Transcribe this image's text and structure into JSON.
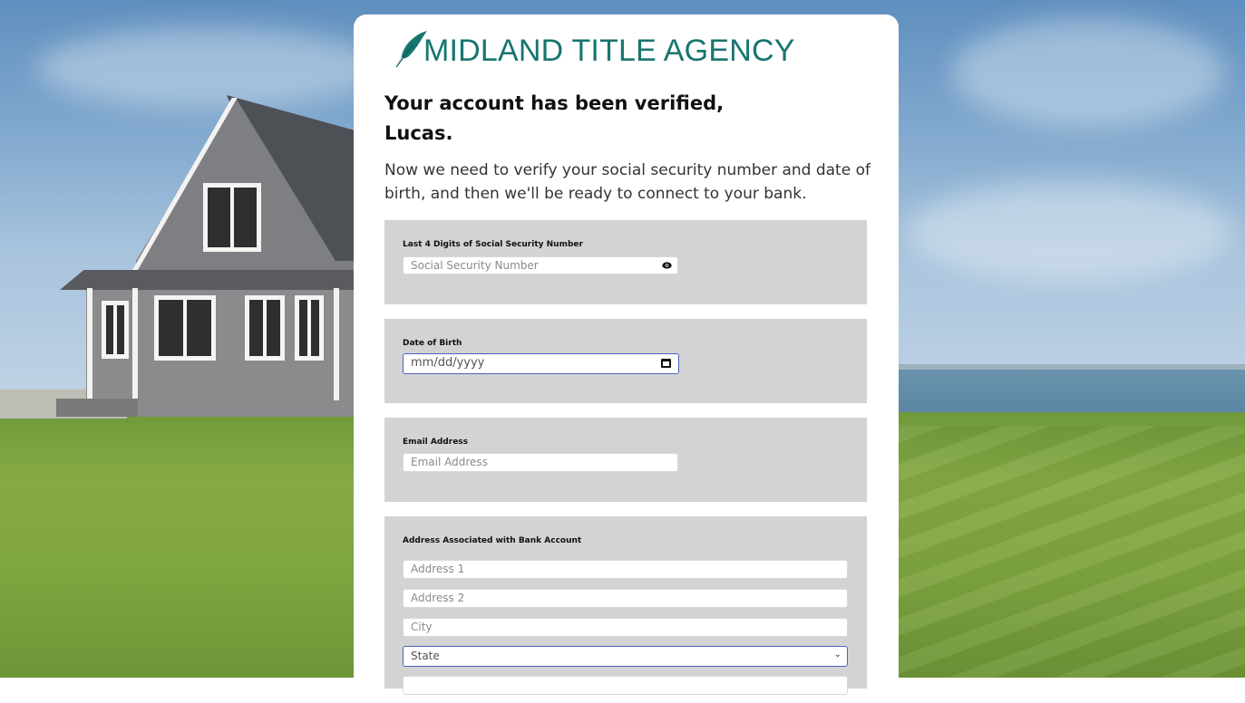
{
  "brand": {
    "name": "MIDLAND TITLE AGENCY",
    "color": "#17756f"
  },
  "heading": {
    "line1": "Your account has been verified,",
    "line2": "Lucas."
  },
  "intro": "Now we need to verify your social security number and date of birth, and then we'll be ready to connect to your bank.",
  "ssn": {
    "label": "Last 4 Digits of Social Security Number",
    "placeholder": "Social Security Number",
    "icon": "eye-icon"
  },
  "dob": {
    "label": "Date of Birth",
    "placeholder": "mm/dd/yyyy",
    "icon": "calendar-icon"
  },
  "email": {
    "label": "Email Address",
    "placeholder": "Email Address"
  },
  "address": {
    "label": "Address Associated with Bank Account",
    "address1_placeholder": "Address 1",
    "address2_placeholder": "Address 2",
    "city_placeholder": "City",
    "state_selected": "State"
  },
  "colors": {
    "panel": "#d3d3d3",
    "focus_border": "#4a63c4"
  }
}
